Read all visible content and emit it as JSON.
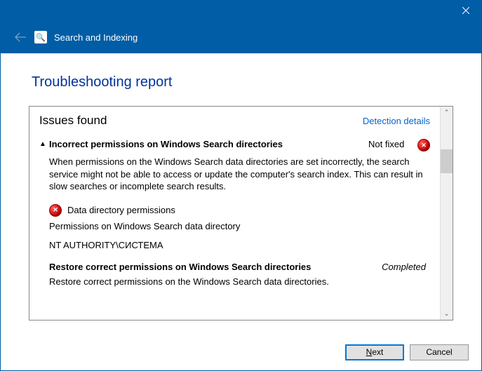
{
  "header": {
    "title": "Search and Indexing"
  },
  "page": {
    "title": "Troubleshooting report"
  },
  "report": {
    "section_title": "Issues found",
    "detection_link": "Detection details",
    "issue": {
      "title": "Incorrect permissions on Windows Search directories",
      "status": "Not fixed",
      "description": "When permissions on the Windows Search data directories are set incorrectly, the search service might not be able to access or update the computer's search index. This can result in slow searches or incomplete search results."
    },
    "sub": {
      "label": "Data directory permissions",
      "desc": "Permissions on Windows Search data directory",
      "account": "NT AUTHORITY\\СИСТЕМА"
    },
    "restore": {
      "title": "Restore correct permissions on Windows Search directories",
      "status": "Completed",
      "desc": "Restore correct permissions on the Windows Search data directories."
    }
  },
  "buttons": {
    "next_prefix": "N",
    "next_rest": "ext",
    "cancel": "Cancel"
  }
}
